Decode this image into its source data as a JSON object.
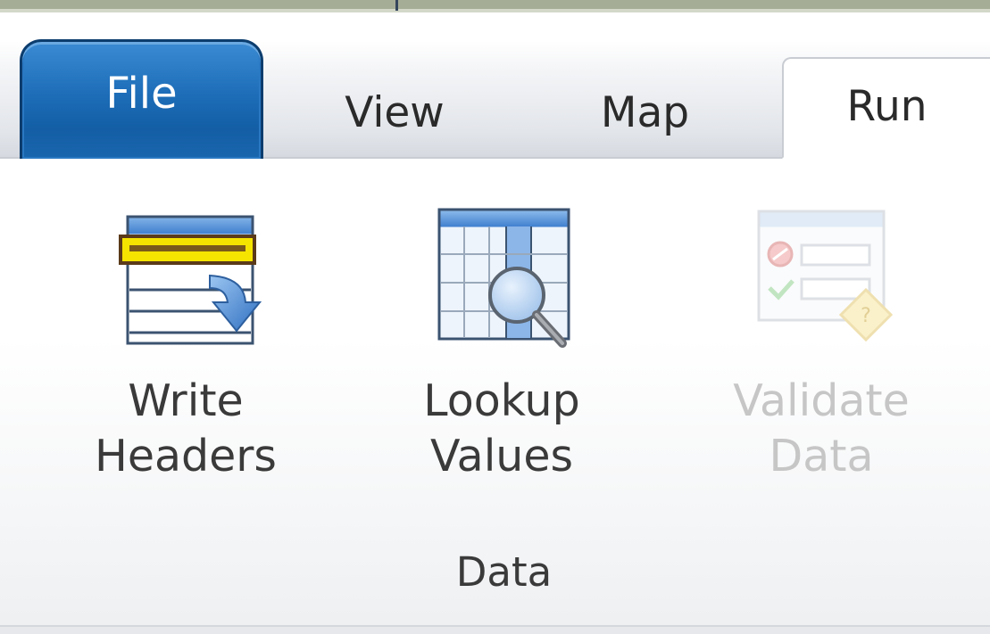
{
  "tabs": [
    {
      "label": "File",
      "selected": false,
      "style": "application-menu"
    },
    {
      "label": "View",
      "selected": false
    },
    {
      "label": "Map",
      "selected": false
    },
    {
      "label": "Run",
      "selected": true
    }
  ],
  "ribbon": {
    "group": {
      "label": "Data",
      "buttons": [
        {
          "line1": "Write",
          "line2": "Headers",
          "icon": "write-headers-icon",
          "enabled": true
        },
        {
          "line1": "Lookup",
          "line2": "Values",
          "icon": "lookup-values-icon",
          "enabled": true
        },
        {
          "line1": "Validate",
          "line2": "Data",
          "icon": "validate-data-icon",
          "enabled": false
        }
      ]
    }
  },
  "colors": {
    "file_tab": "#1d6db8",
    "highlight_yellow": "#f5e400",
    "disabled_text": "#c6c6c6"
  }
}
